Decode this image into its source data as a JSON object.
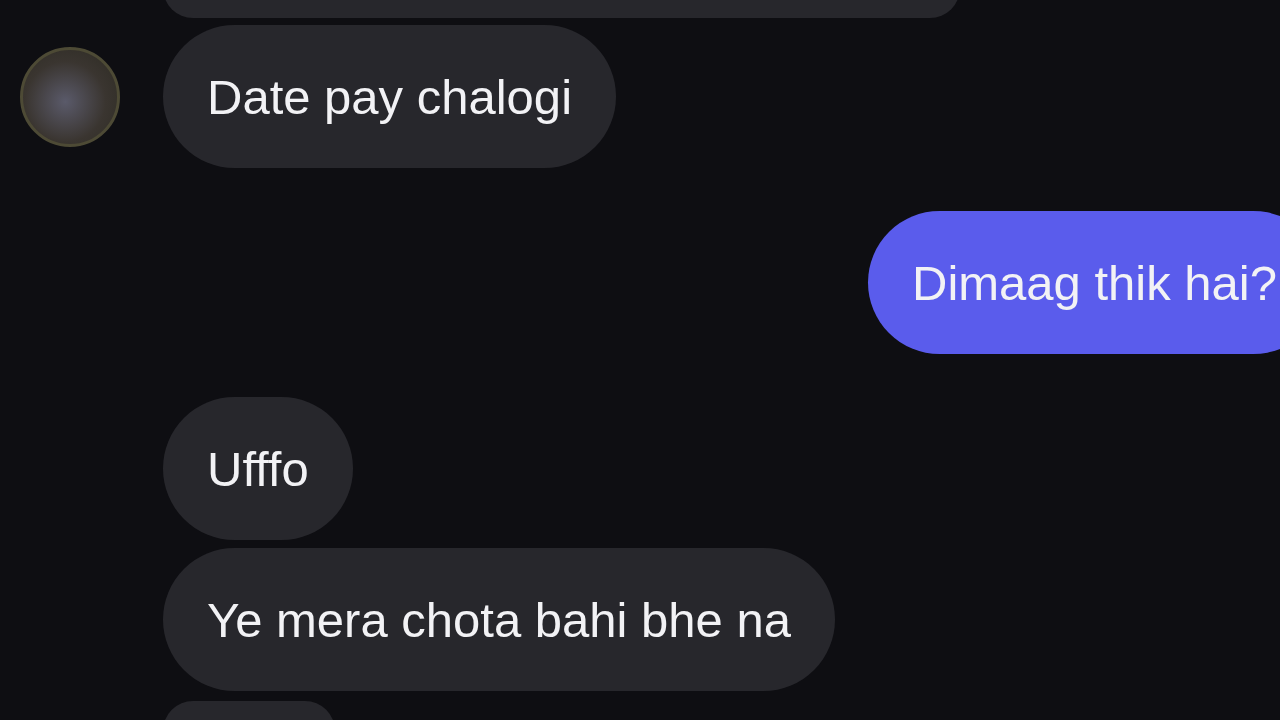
{
  "messages": [
    {
      "kind": "received",
      "text": "Date pay chalogi",
      "avatar": true
    },
    {
      "kind": "sent",
      "text": "Dimaag thik hai?",
      "avatar": false
    },
    {
      "kind": "received",
      "text": "Ufffo",
      "avatar": false
    },
    {
      "kind": "received",
      "text": "Ye mera chota bahi bhe na",
      "avatar": false
    }
  ]
}
